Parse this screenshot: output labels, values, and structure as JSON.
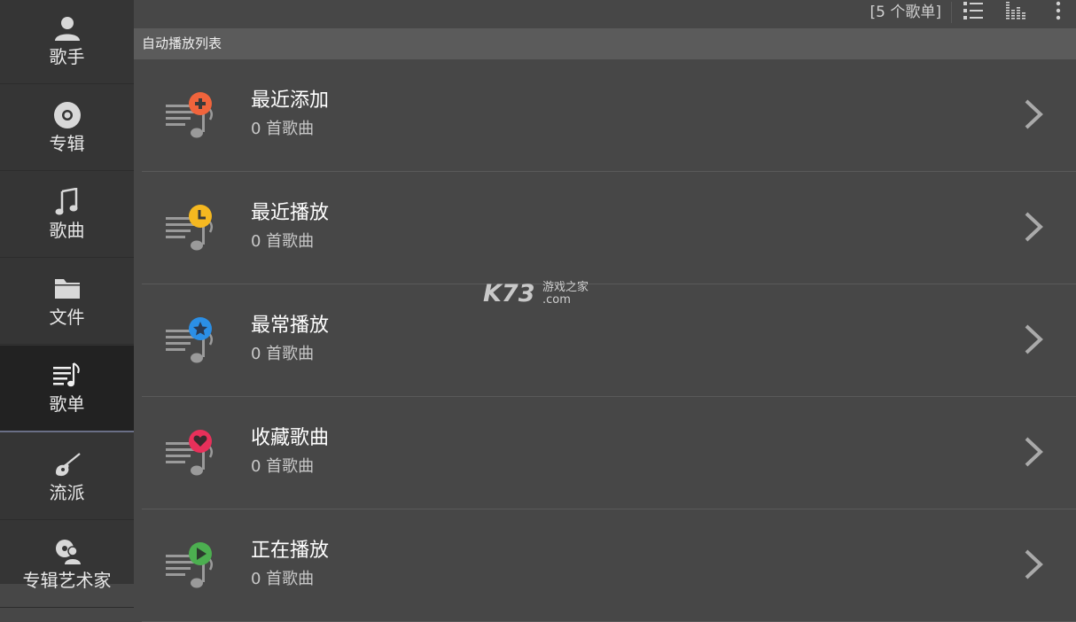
{
  "sidebar": {
    "items": [
      {
        "label": "歌手",
        "icon": "person-icon"
      },
      {
        "label": "专辑",
        "icon": "disc-icon"
      },
      {
        "label": "歌曲",
        "icon": "music-note-icon"
      },
      {
        "label": "文件",
        "icon": "folder-icon"
      },
      {
        "label": "歌单",
        "icon": "playlist-icon",
        "active": true
      },
      {
        "label": "流派",
        "icon": "guitar-icon"
      },
      {
        "label": "专辑艺术家",
        "icon": "artist-disc-icon"
      }
    ]
  },
  "toolbar": {
    "count_label": "[5 个歌单]"
  },
  "section": {
    "title": "自动播放列表"
  },
  "playlists": [
    {
      "title": "最近添加",
      "subtitle": "0 首歌曲",
      "badge": "plus-icon",
      "badge_color": "#f0643c"
    },
    {
      "title": "最近播放",
      "subtitle": "0 首歌曲",
      "badge": "clock-icon",
      "badge_color": "#f5b820"
    },
    {
      "title": "最常播放",
      "subtitle": "0 首歌曲",
      "badge": "star-icon",
      "badge_color": "#2b8fe6"
    },
    {
      "title": "收藏歌曲",
      "subtitle": "0 首歌曲",
      "badge": "heart-icon",
      "badge_color": "#e8305a"
    },
    {
      "title": "正在播放",
      "subtitle": "0 首歌曲",
      "badge": "play-icon",
      "badge_color": "#4caf50"
    }
  ],
  "watermark": {
    "brand": "K73",
    "text": "游戏之家",
    "domain": ".com"
  }
}
